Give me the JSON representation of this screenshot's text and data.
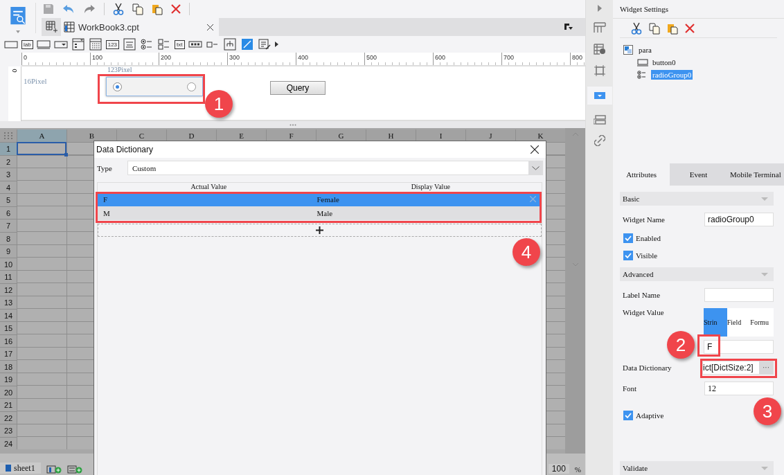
{
  "toolbar": {
    "tab": {
      "title": "WorkBook3.cpt"
    }
  },
  "palette": [
    {
      "kind": "field"
    },
    {
      "kind": "tag",
      "label": "lab"
    },
    {
      "kind": "button"
    },
    {
      "kind": "dropdown"
    },
    {
      "kind": "dropdown-list"
    },
    {
      "kind": "calendar"
    },
    {
      "kind": "tag",
      "label": "123"
    },
    {
      "kind": "text-area"
    },
    {
      "kind": "radio-group"
    },
    {
      "kind": "check-group"
    },
    {
      "kind": "tag",
      "label": "txt"
    },
    {
      "kind": "password"
    },
    {
      "kind": "checkbox"
    },
    {
      "kind": "tree"
    },
    {
      "kind": "edit"
    },
    {
      "kind": "list-edit"
    }
  ],
  "ruler": {
    "x_labels": [
      "0",
      "100",
      "200",
      "300",
      "400",
      "500",
      "600",
      "700",
      "800"
    ],
    "y_labels": [
      "0"
    ]
  },
  "canvas": {
    "width_label": "123Pixel",
    "height_label": "16Pixel",
    "radio_group": [
      {
        "selected": true
      },
      {
        "selected": false
      }
    ],
    "query_button": "Query"
  },
  "sheet": {
    "columns": [
      {
        "label": "A",
        "selected": true
      },
      {
        "label": "B",
        "selected": false
      },
      {
        "label": "C",
        "selected": false
      },
      {
        "label": "D",
        "selected": false
      },
      {
        "label": "E",
        "selected": false
      },
      {
        "label": "F",
        "selected": false
      },
      {
        "label": "G",
        "selected": false
      },
      {
        "label": "H",
        "selected": false
      },
      {
        "label": "I",
        "selected": false
      },
      {
        "label": "J",
        "selected": false
      },
      {
        "label": "K",
        "selected": false
      }
    ],
    "rows": [
      {
        "label": "1",
        "selected": true
      },
      {
        "label": "2",
        "selected": false
      },
      {
        "label": "3",
        "selected": false
      },
      {
        "label": "4",
        "selected": false
      },
      {
        "label": "5",
        "selected": false
      },
      {
        "label": "6",
        "selected": false
      },
      {
        "label": "7",
        "selected": false
      },
      {
        "label": "8",
        "selected": false
      },
      {
        "label": "9",
        "selected": false
      },
      {
        "label": "10",
        "selected": false
      },
      {
        "label": "11",
        "selected": false
      },
      {
        "label": "12",
        "selected": false
      },
      {
        "label": "13",
        "selected": false
      },
      {
        "label": "14",
        "selected": false
      },
      {
        "label": "15",
        "selected": false
      },
      {
        "label": "16",
        "selected": false
      },
      {
        "label": "17",
        "selected": false
      },
      {
        "label": "18",
        "selected": false
      },
      {
        "label": "19",
        "selected": false
      },
      {
        "label": "20",
        "selected": false
      },
      {
        "label": "21",
        "selected": false
      },
      {
        "label": "22",
        "selected": false
      },
      {
        "label": "23",
        "selected": false
      },
      {
        "label": "24",
        "selected": false
      }
    ],
    "tab": "sheet1",
    "zoom": "100",
    "zoom_unit": "%"
  },
  "dialog": {
    "title": "Data Dictionary",
    "type_label": "Type",
    "type_value": "Custom",
    "columns": [
      "Actual Value",
      "Display Value"
    ],
    "rows": [
      {
        "actual": "F",
        "display": "Female",
        "selected": true
      },
      {
        "actual": "M",
        "display": "Male",
        "selected": false
      }
    ]
  },
  "panel": {
    "title": "Widget Settings",
    "tree": {
      "label": "para",
      "children": [
        {
          "label": "button0",
          "kind": "button",
          "selected": false
        },
        {
          "label": "radioGroup0",
          "kind": "radio",
          "selected": true
        }
      ]
    },
    "tabs": [
      {
        "label": "Attributes",
        "selected": true
      },
      {
        "label": "Event",
        "selected": false
      },
      {
        "label": "Mobile Terminal",
        "selected": false
      }
    ],
    "basic": {
      "title": "Basic",
      "widget_name": {
        "label": "Widget Name",
        "value": "radioGroup0"
      },
      "checks": [
        {
          "label": "Enabled",
          "checked": true
        },
        {
          "label": "Visible",
          "checked": true
        }
      ]
    },
    "advanced": {
      "title": "Advanced",
      "label_name": {
        "label": "Label Name"
      },
      "widget_value": {
        "label": "Widget Value",
        "modes": [
          {
            "label": "Strin",
            "selected": true
          },
          {
            "label": "Field",
            "selected": false
          },
          {
            "label": "Formu",
            "selected": false
          }
        ],
        "value": "F"
      },
      "data_dictionary": {
        "label": "Data Dictionary",
        "value": "ict[DictSize:2]",
        "button": "···"
      },
      "font": {
        "label": "Font",
        "value": "12"
      },
      "checks": [
        {
          "label": "Adaptive",
          "checked": true
        }
      ]
    },
    "validate": {
      "title": "Validate"
    }
  },
  "annotations": [
    {
      "label": "1"
    },
    {
      "label": "2"
    },
    {
      "label": "3"
    },
    {
      "label": "4"
    }
  ]
}
